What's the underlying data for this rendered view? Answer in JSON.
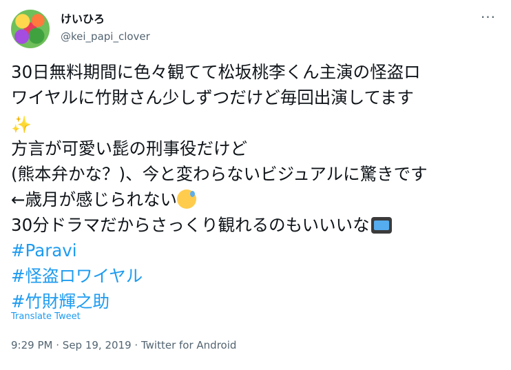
{
  "user": {
    "display_name": "けいひろ",
    "handle": "@kei_papi_clover"
  },
  "more_label": "···",
  "tweet": {
    "lines": [
      "30日無料期間に色々観てて松坂桃李くん主演の怪盗ロ",
      "ワイヤルに竹財さん少しずつだけど毎回出演してます",
      "✨",
      "方言が可愛い髭の刑事役だけど",
      "(熊本弁かな？)、今と変わらないビジュアルに驚きです",
      "←歳月が感じられない",
      "30分ドラマだからさっくり観れるのもいいいな"
    ],
    "hashtags": [
      "#Paravi",
      "#怪盗ロワイヤル",
      "#竹財輝之助"
    ],
    "emoji": {
      "sparkles": "sparkles-icon",
      "sweat": "sweat-smile-icon",
      "tv": "television-icon"
    }
  },
  "translate_label": "Translate Tweet",
  "meta": {
    "time": "9:29 PM",
    "date": "Sep 19, 2019",
    "source": "Twitter for Android",
    "separator": "·"
  },
  "colors": {
    "link": "#1d9bf0",
    "secondary": "#536471",
    "text": "#0f1419"
  }
}
